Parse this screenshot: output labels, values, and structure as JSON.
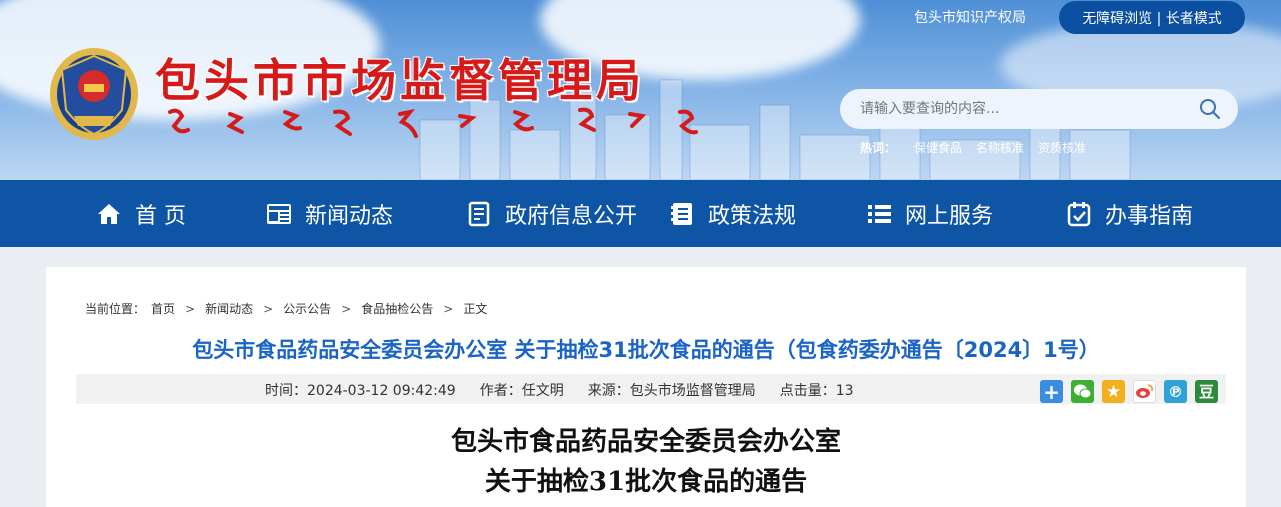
{
  "header": {
    "site_title": "包头市市场监督管理局",
    "top_link": "包头市知识产权局",
    "accessibility": "无障碍浏览 | 长者模式",
    "search": {
      "placeholder": "请输入要查询的内容..."
    },
    "hot": {
      "label": "热词：",
      "items": [
        "保健食品",
        "名称核准",
        "资质核准"
      ]
    }
  },
  "nav": {
    "items": [
      {
        "label": "首 页",
        "icon": "home-icon"
      },
      {
        "label": "新闻动态",
        "icon": "news-icon"
      },
      {
        "label": "政府信息公开",
        "icon": "document-icon"
      },
      {
        "label": "政策法规",
        "icon": "book-icon"
      },
      {
        "label": "网上服务",
        "icon": "list-icon"
      },
      {
        "label": "办事指南",
        "icon": "guide-icon"
      }
    ]
  },
  "breadcrumb": {
    "label": "当前位置：",
    "items": [
      "首页",
      "新闻动态",
      "公示公告",
      "食品抽检公告",
      "正文"
    ]
  },
  "article": {
    "title": "包头市食品药品安全委员会办公室 关于抽检31批次食品的通告（包食药委办通告〔2024〕1号）",
    "time": "时间：2024-03-12 09:42:49",
    "author": "作者：任文明",
    "source": "来源：包头市场监督管理局",
    "clicks": "点击量：13",
    "doc_title_line1": "包头市食品药品安全委员会办公室",
    "doc_title_line2": "关于抽检31批次食品的通告"
  },
  "share": {
    "buttons": [
      {
        "icon": "more-share-icon",
        "color": "#3a8de0",
        "glyph": "+"
      },
      {
        "icon": "wechat-icon",
        "color": "#3cb034",
        "glyph": "◉"
      },
      {
        "icon": "qzone-icon",
        "color": "#f2b01e",
        "glyph": "★"
      },
      {
        "icon": "weibo-icon",
        "color": "#e0453a",
        "glyph": "◎"
      },
      {
        "icon": "tencent-weibo-icon",
        "color": "#2fa3d8",
        "glyph": "℗"
      },
      {
        "icon": "douban-icon",
        "color": "#2d8a3a",
        "glyph": "豆"
      }
    ]
  },
  "colors": {
    "nav_bg": "#0e56a5",
    "title_red": "#d61a1a",
    "article_title_blue": "#1a64c6"
  }
}
